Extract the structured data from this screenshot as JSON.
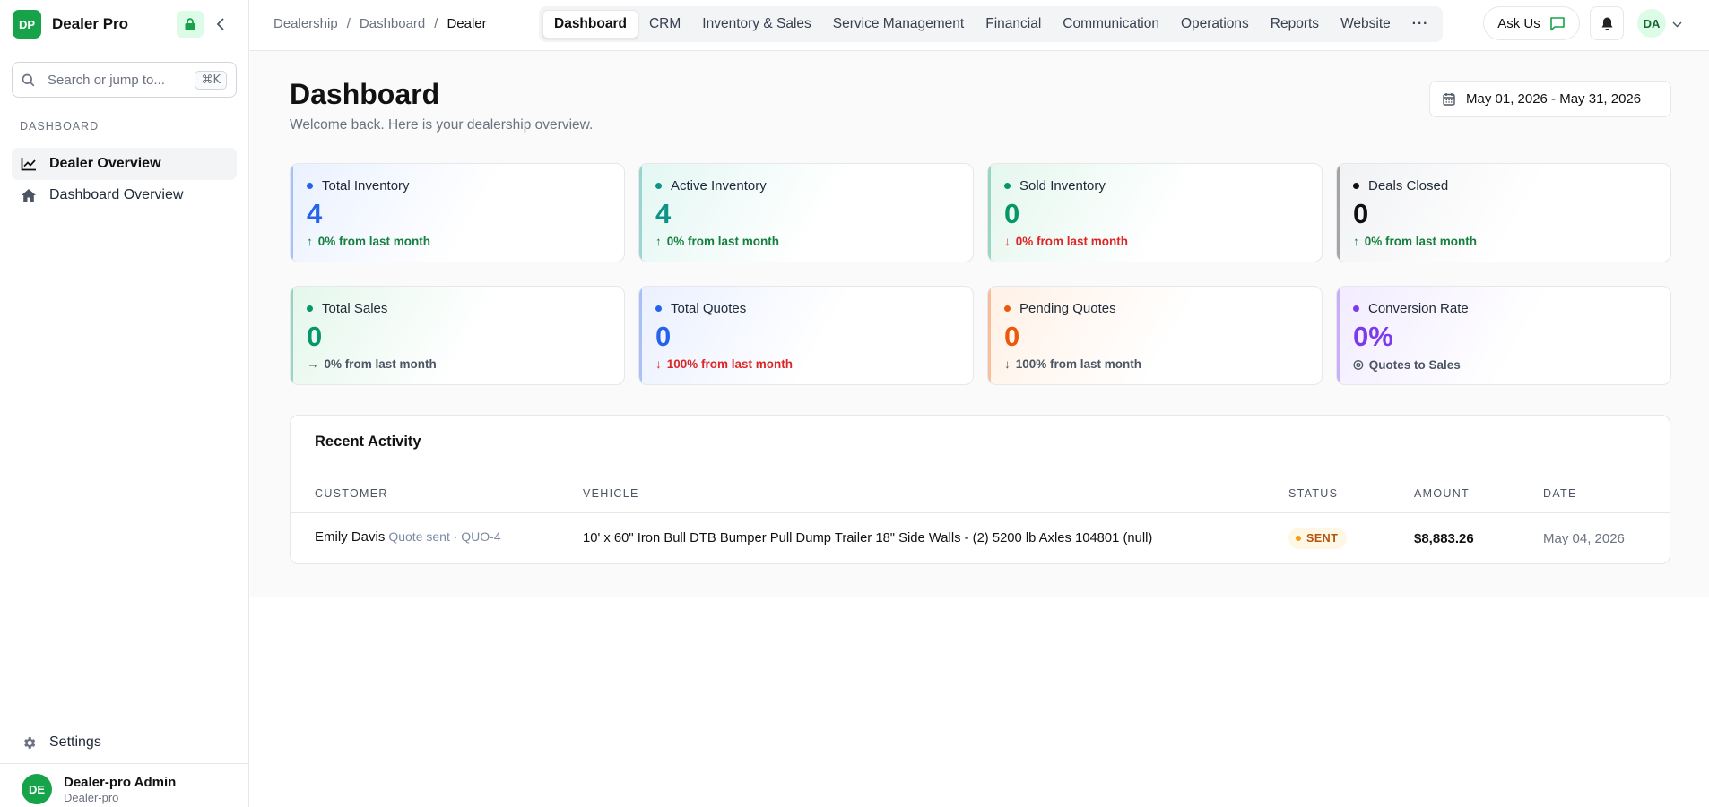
{
  "brand": {
    "initials": "DP",
    "name": "Dealer Pro"
  },
  "search": {
    "placeholder": "Search or jump to...",
    "shortcut": "⌘K"
  },
  "sidebar": {
    "section": "DASHBOARD",
    "items": [
      {
        "label": "Dealer Overview",
        "icon": "chart-line-icon",
        "active": true
      },
      {
        "label": "Dashboard Overview",
        "icon": "home-icon",
        "active": false
      }
    ],
    "settings_label": "Settings",
    "user": {
      "initials": "DE",
      "name": "Dealer-pro Admin",
      "org": "Dealer-pro"
    }
  },
  "breadcrumb": [
    "Dealership",
    "/",
    "Dashboard",
    "/",
    "Dealer"
  ],
  "tabs": [
    "Dashboard",
    "CRM",
    "Inventory & Sales",
    "Service Management",
    "Financial",
    "Communication",
    "Operations",
    "Reports",
    "Website",
    "···"
  ],
  "header_actions": {
    "ask_label": "Ask Us",
    "avatar_initials": "DA"
  },
  "page": {
    "title": "Dashboard",
    "subtitle": "Welcome back. Here is your dealership overview.",
    "date_range": "May 01, 2026 - May 31, 2026"
  },
  "stats": [
    {
      "label": "Total Inventory",
      "value": "4",
      "trend": "0% from last month",
      "arrow": "↑",
      "color": "#2563eb",
      "trend_color": "#15803d",
      "bg": "#eaf1ff"
    },
    {
      "label": "Active Inventory",
      "value": "4",
      "trend": "0% from last month",
      "arrow": "↑",
      "color": "#0d9488",
      "trend_color": "#15803d",
      "bg": "#e3f7f3"
    },
    {
      "label": "Sold Inventory",
      "value": "0",
      "trend": "0% from last month",
      "arrow": "↓",
      "color": "#059669",
      "trend_color": "#dc2626",
      "bg": "#e4f7ee"
    },
    {
      "label": "Deals Closed",
      "value": "0",
      "trend": "0% from last month",
      "arrow": "↑",
      "color": "#111111",
      "trend_color": "#15803d",
      "bg": "#f1f2f4"
    },
    {
      "label": "Total Sales",
      "value": "0",
      "trend": "0% from last month",
      "arrow": "→",
      "color": "#059669",
      "trend_color": "#4b5563",
      "bg": "#e4f7ec"
    },
    {
      "label": "Total Quotes",
      "value": "0",
      "trend": "100% from last month",
      "arrow": "↓",
      "color": "#2563eb",
      "trend_color": "#dc2626",
      "bg": "#eaf0ff"
    },
    {
      "label": "Pending Quotes",
      "value": "0",
      "trend": "100% from last month",
      "arrow": "↓",
      "color": "#ea580c",
      "trend_color": "#4b5563",
      "bg": "#fff1e6"
    },
    {
      "label": "Conversion Rate",
      "value": "0%",
      "trend": "Quotes to Sales",
      "arrow": "◎",
      "color": "#7c3aed",
      "trend_color": "#4b5563",
      "bg": "#f2ecff"
    }
  ],
  "activity": {
    "title": "Recent Activity",
    "columns": [
      "CUSTOMER",
      "VEHICLE",
      "STATUS",
      "AMOUNT",
      "DATE"
    ],
    "rows": [
      {
        "customer": "Emily Davis",
        "note": "Quote sent · QUO-4",
        "vehicle": "10' x 60\" Iron Bull DTB Bumper Pull Dump Trailer 18\" Side Walls - (2) 5200 lb Axles 104801 (null)",
        "status": "SENT",
        "amount": "$8,883.26",
        "date": "May 04, 2026"
      }
    ]
  }
}
